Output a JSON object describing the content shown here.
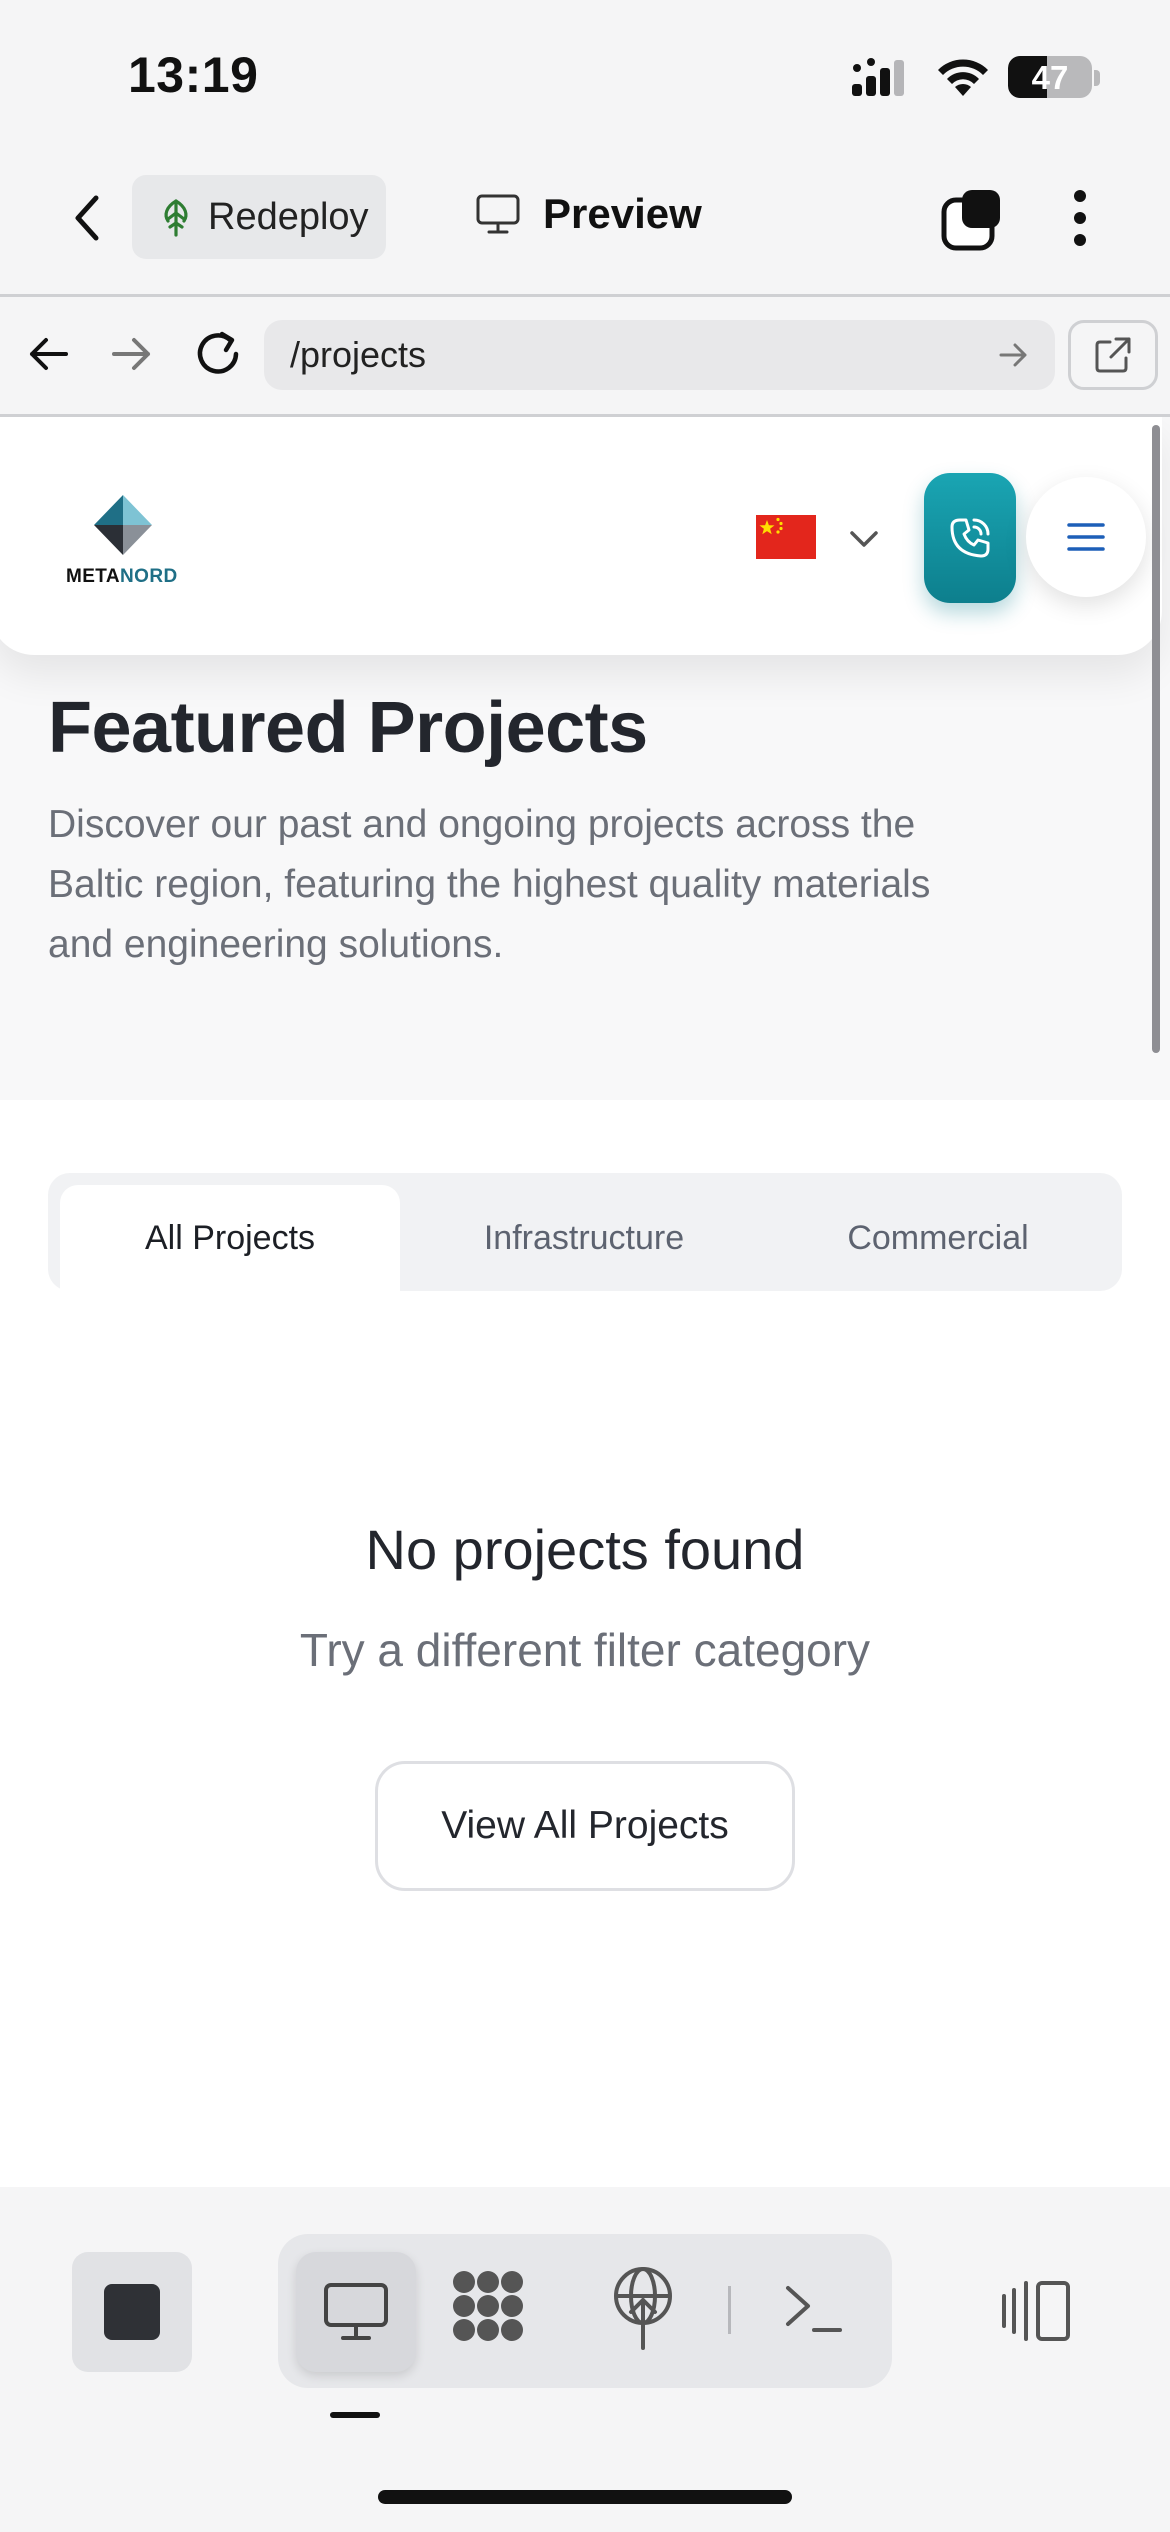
{
  "status_bar": {
    "time": "13:19",
    "battery": "47",
    "battery_level_percent": 47
  },
  "toolbar": {
    "redeploy_label": "Redeploy",
    "preview_label": "Preview"
  },
  "browser": {
    "url": "/projects"
  },
  "site": {
    "logo_text_part1": "META",
    "logo_text_part2": "NORD",
    "language_flag": "flag-china-icon"
  },
  "hero": {
    "title": "Featured Projects",
    "description": "Discover our past and ongoing projects across the Baltic region, featuring the highest quality materials and engineering solutions."
  },
  "filters": {
    "tabs": [
      {
        "label": "All Projects",
        "active": true
      },
      {
        "label": "Infrastructure",
        "active": false
      },
      {
        "label": "Commercial",
        "active": false
      }
    ]
  },
  "empty_state": {
    "title": "No projects found",
    "subtitle": "Try a different filter category",
    "button_label": "View All Projects"
  },
  "colors": {
    "accent_teal": "#0d7f8d",
    "menu_blue": "#1d5fb8",
    "redeploy_green": "#2e7d32"
  }
}
